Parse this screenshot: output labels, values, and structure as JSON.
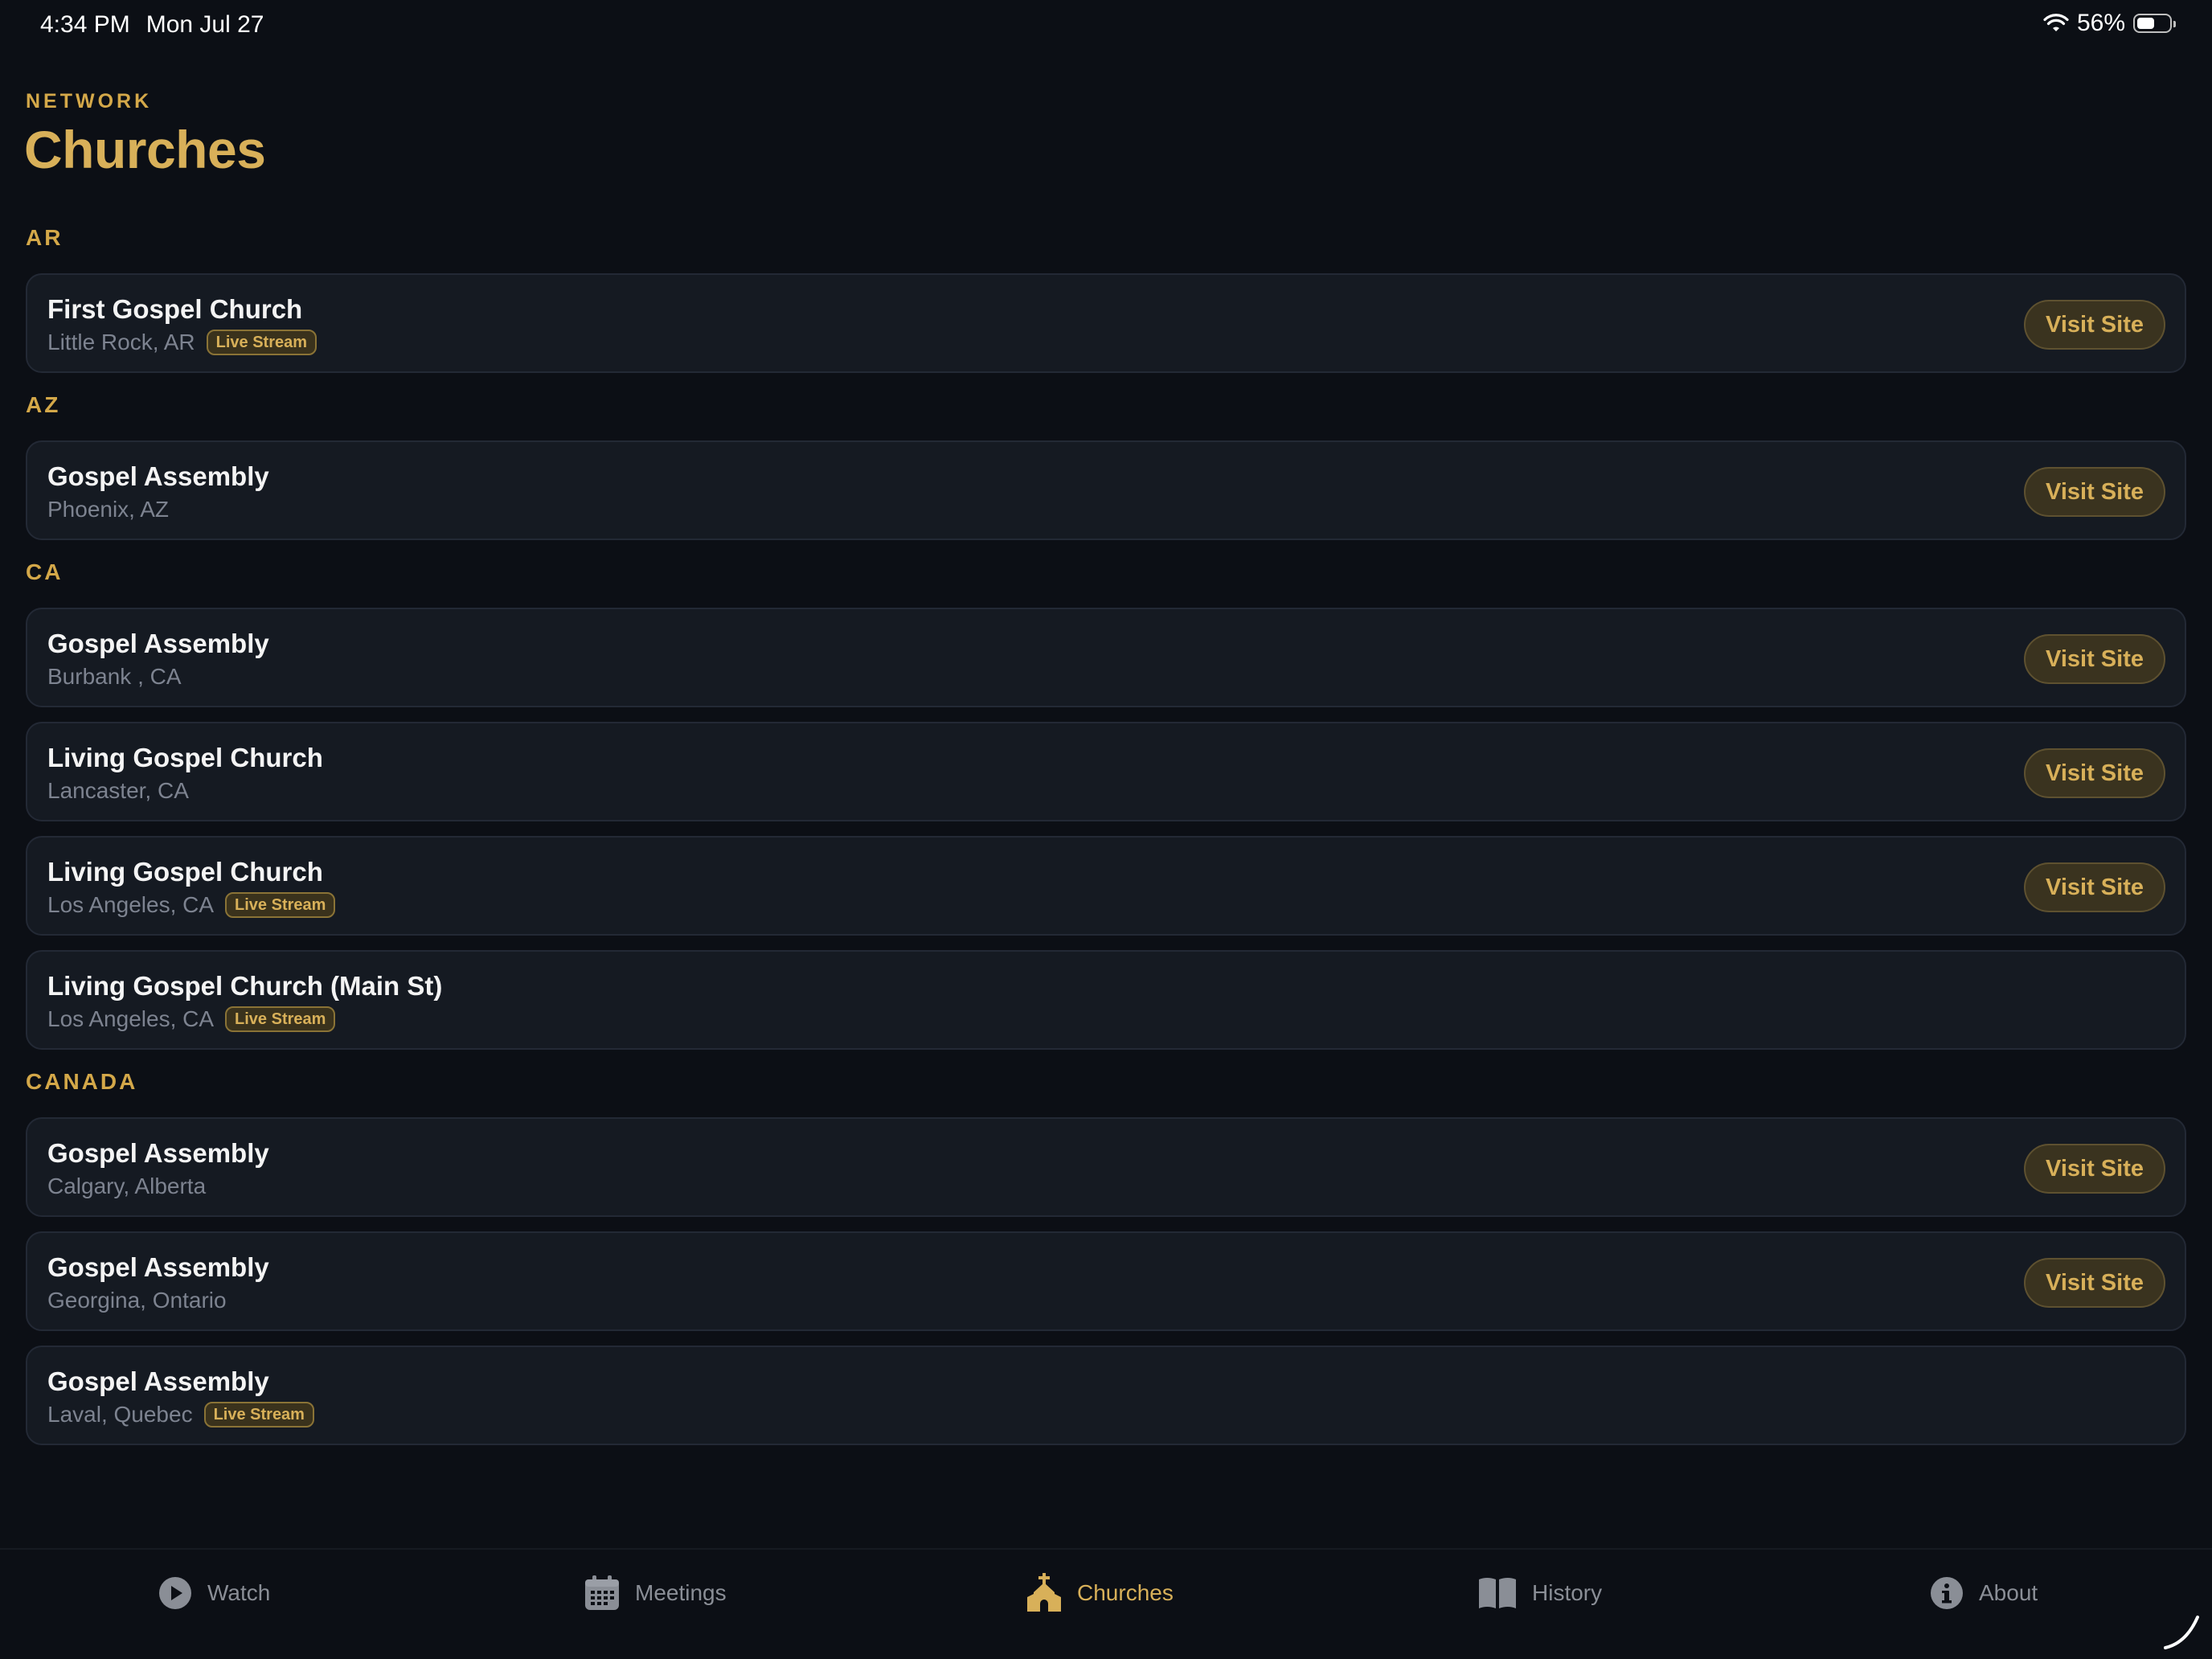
{
  "status_bar": {
    "time": "4:34 PM",
    "date": "Mon Jul 27",
    "battery_percent_label": "56%",
    "battery_level": 0.56
  },
  "header": {
    "eyebrow": "NETWORK",
    "title": "Churches"
  },
  "visit_label": "Visit Site",
  "live_label": "Live Stream",
  "sections": [
    {
      "label": "AR",
      "churches": [
        {
          "name": "First Gospel Church",
          "location": "Little Rock, AR",
          "live": true,
          "visit": true
        }
      ]
    },
    {
      "label": "AZ",
      "churches": [
        {
          "name": "Gospel Assembly",
          "location": "Phoenix, AZ",
          "live": false,
          "visit": true
        }
      ]
    },
    {
      "label": "CA",
      "churches": [
        {
          "name": "Gospel Assembly",
          "location": "Burbank , CA",
          "live": false,
          "visit": true
        },
        {
          "name": "Living Gospel Church",
          "location": "Lancaster, CA",
          "live": false,
          "visit": true
        },
        {
          "name": "Living Gospel Church",
          "location": "Los Angeles, CA",
          "live": true,
          "visit": true
        },
        {
          "name": "Living Gospel Church (Main St)",
          "location": "Los Angeles, CA",
          "live": true,
          "visit": false
        }
      ]
    },
    {
      "label": "CANADA",
      "churches": [
        {
          "name": "Gospel Assembly",
          "location": "Calgary, Alberta",
          "live": false,
          "visit": true
        },
        {
          "name": "Gospel Assembly",
          "location": "Georgina, Ontario",
          "live": false,
          "visit": true
        },
        {
          "name": "Gospel Assembly",
          "location": "Laval, Quebec",
          "live": true,
          "visit": false
        }
      ]
    }
  ],
  "tabs": [
    {
      "label": "Watch",
      "icon": "play-circle-icon",
      "active": false
    },
    {
      "label": "Meetings",
      "icon": "calendar-icon",
      "active": false
    },
    {
      "label": "Churches",
      "icon": "church-icon",
      "active": true
    },
    {
      "label": "History",
      "icon": "book-icon",
      "active": false
    },
    {
      "label": "About",
      "icon": "info-circle-icon",
      "active": false
    }
  ],
  "colors": {
    "background": "#0c0f15",
    "card": "#151a22",
    "accent": "#d8b059",
    "inactive_tab": "#8a8e96"
  }
}
